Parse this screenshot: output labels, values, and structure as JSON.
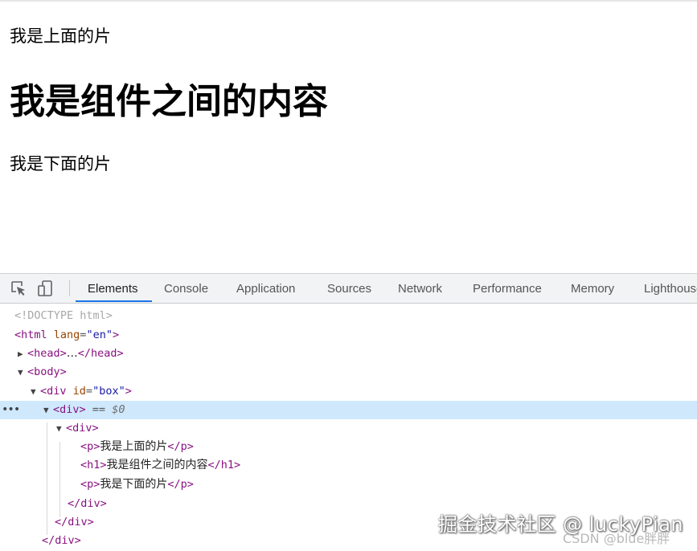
{
  "preview": {
    "p_top": "我是上面的片",
    "h1": "我是组件之间的内容",
    "p_bottom": "我是下面的片"
  },
  "devtools": {
    "tabs": [
      "Elements",
      "Console",
      "Application",
      "Sources",
      "Network",
      "Performance",
      "Memory",
      "Lighthouse"
    ],
    "active_tab": "Elements",
    "accent_color": "#1a73e8",
    "selected_row_color": "#cfe8fc"
  },
  "dom_tree": {
    "doctype": "<!DOCTYPE html>",
    "html_open": "<html",
    "html_lang_attr": "lang",
    "html_lang_val": "\"en\"",
    "head_open": "<head>",
    "head_ellipsis": "…",
    "head_close": "</head>",
    "body_open": "<body>",
    "div_box_open": "<div",
    "div_box_attr": "id",
    "div_box_val": "\"box\"",
    "div_selected_open": "<div>",
    "selected_marker_eq": "==",
    "selected_marker_var": "$0",
    "div_inner_open": "<div>",
    "p_open": "<p>",
    "p_close": "</p>",
    "p1_text": "我是上面的片",
    "h1_open": "<h1>",
    "h1_close": "</h1>",
    "h1_text": "我是组件之间的内容",
    "p2_text": "我是下面的片",
    "div_close": "</div>",
    "gt": ">",
    "eq_sign": "="
  },
  "watermarks": {
    "juejin": "掘金技术社区 @ luckyPian",
    "csdn": "CSDN @blue胖胖"
  },
  "icons": [
    "inspect-element-icon",
    "device-toolbar-icon",
    "expand-arrow-icon",
    "collapse-arrow-icon",
    "more-dots-icon"
  ]
}
